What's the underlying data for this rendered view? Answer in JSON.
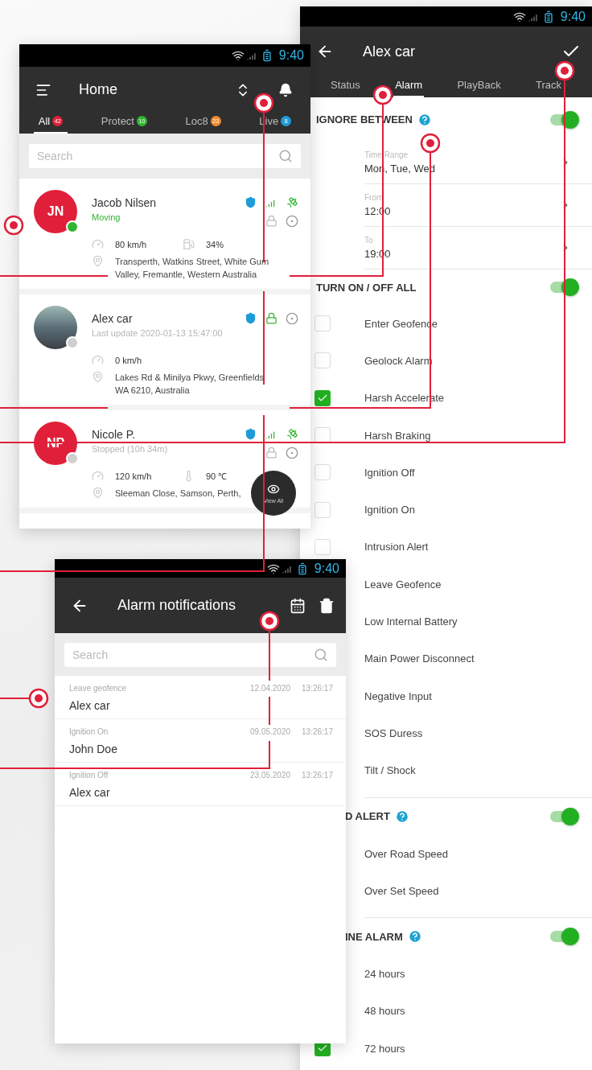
{
  "home": {
    "time": "9:40",
    "title": "Home",
    "tabs": [
      {
        "label": "All",
        "count": "42",
        "color": "#e0203a",
        "selected": true
      },
      {
        "label": "Protect",
        "count": "10",
        "color": "#2fb52f",
        "selected": false
      },
      {
        "label": "Loc8",
        "count": "23",
        "color": "#f08a2c",
        "selected": false
      },
      {
        "label": "Live",
        "count": "8",
        "color": "#1f9bd7",
        "selected": false
      }
    ],
    "search": {
      "placeholder": "Search"
    },
    "vehicles": [
      {
        "initials": "JN",
        "name": "Jacob Nilsen",
        "status": "Moving",
        "online": true,
        "gps": true,
        "locked": false,
        "speed": "80 km/h",
        "extra": {
          "kind": "fuel",
          "value": "34%"
        },
        "address": "Transperth, Watkins Street, White Gum Valley, Fremantle, Western Australia"
      },
      {
        "name": "Alex car",
        "status": "Last update 2020-01-13 15:47:00",
        "online": false,
        "gps": false,
        "locked": true,
        "speed": "0 km/h",
        "address": "Lakes Rd & Minilya Pkwy, Greenfields WA 6210, Australia"
      },
      {
        "initials": "NP",
        "name": "Nicole P.",
        "status": "Stopped (10h 34m)",
        "online": false,
        "gps": true,
        "locked": false,
        "speed": "120 km/h",
        "extra": {
          "kind": "temperature",
          "value": "90 ℃"
        },
        "address": "Sleeman Close, Samson, Perth,"
      }
    ],
    "fab": "View All"
  },
  "settings": {
    "time": "9:40",
    "title": "Alex car",
    "tabs": [
      {
        "label": "Status",
        "selected": false
      },
      {
        "label": "Alarm",
        "selected": true
      },
      {
        "label": "PlayBack",
        "selected": false
      },
      {
        "label": "Track",
        "selected": false
      }
    ],
    "sections": [
      {
        "title": "IGNORE BETWEEN",
        "help": true,
        "on": true,
        "items": [
          {
            "kind": "setting",
            "label": "Time Range",
            "value": "Mon, Tue, Wed"
          },
          {
            "kind": "setting",
            "label": "From",
            "value": "12:00"
          },
          {
            "kind": "setting",
            "label": "To",
            "value": "19:00"
          }
        ]
      },
      {
        "title": "TURN ON / OFF ALL",
        "help": false,
        "on": true,
        "items": [
          {
            "kind": "check",
            "label": "Enter Geofence",
            "checked": false
          },
          {
            "kind": "check",
            "label": "Geolock Alarm",
            "checked": false
          },
          {
            "kind": "check",
            "label": "Harsh Accelerate",
            "checked": true
          },
          {
            "kind": "check",
            "label": "Harsh Braking",
            "checked": false
          },
          {
            "kind": "check",
            "label": "Ignition Off",
            "checked": false
          },
          {
            "kind": "check",
            "label": "Ignition On",
            "checked": false
          },
          {
            "kind": "check",
            "label": "Intrusion Alert",
            "checked": false
          },
          {
            "kind": "plain",
            "label": "Leave Geofence"
          },
          {
            "kind": "plain",
            "label": "Low Internal Battery"
          },
          {
            "kind": "plain",
            "label": "Main Power Disconnect"
          },
          {
            "kind": "plain",
            "label": "Negative Input"
          },
          {
            "kind": "plain",
            "label": "SOS Duress"
          },
          {
            "kind": "plain",
            "label": "Tilt / Shock"
          }
        ]
      },
      {
        "title": "D ALERT",
        "help": true,
        "on": true,
        "items": [
          {
            "kind": "plain",
            "label": "Over Road Speed"
          },
          {
            "kind": "plain",
            "label": "Over Set Speed"
          }
        ]
      },
      {
        "title": "INE ALARM",
        "help": true,
        "on": true,
        "items": [
          {
            "kind": "plain",
            "label": "24 hours"
          },
          {
            "kind": "plain",
            "label": "48 hours"
          },
          {
            "kind": "check",
            "label": "72 hours",
            "checked": true
          }
        ]
      }
    ]
  },
  "alarms": {
    "time": "9:40",
    "title": "Alarm notifications",
    "search": {
      "placeholder": "Search"
    },
    "rows": [
      {
        "type": "Leave geofence",
        "name": "Alex car",
        "date": "12.04.2020",
        "time": "13:26:17"
      },
      {
        "type": "Ignition On",
        "name": "John Doe",
        "date": "09.05.2020",
        "time": "13:26:17"
      },
      {
        "type": "Ignition Off",
        "name": "Alex car",
        "date": "23.05.2020",
        "time": "13:26:17"
      }
    ]
  }
}
